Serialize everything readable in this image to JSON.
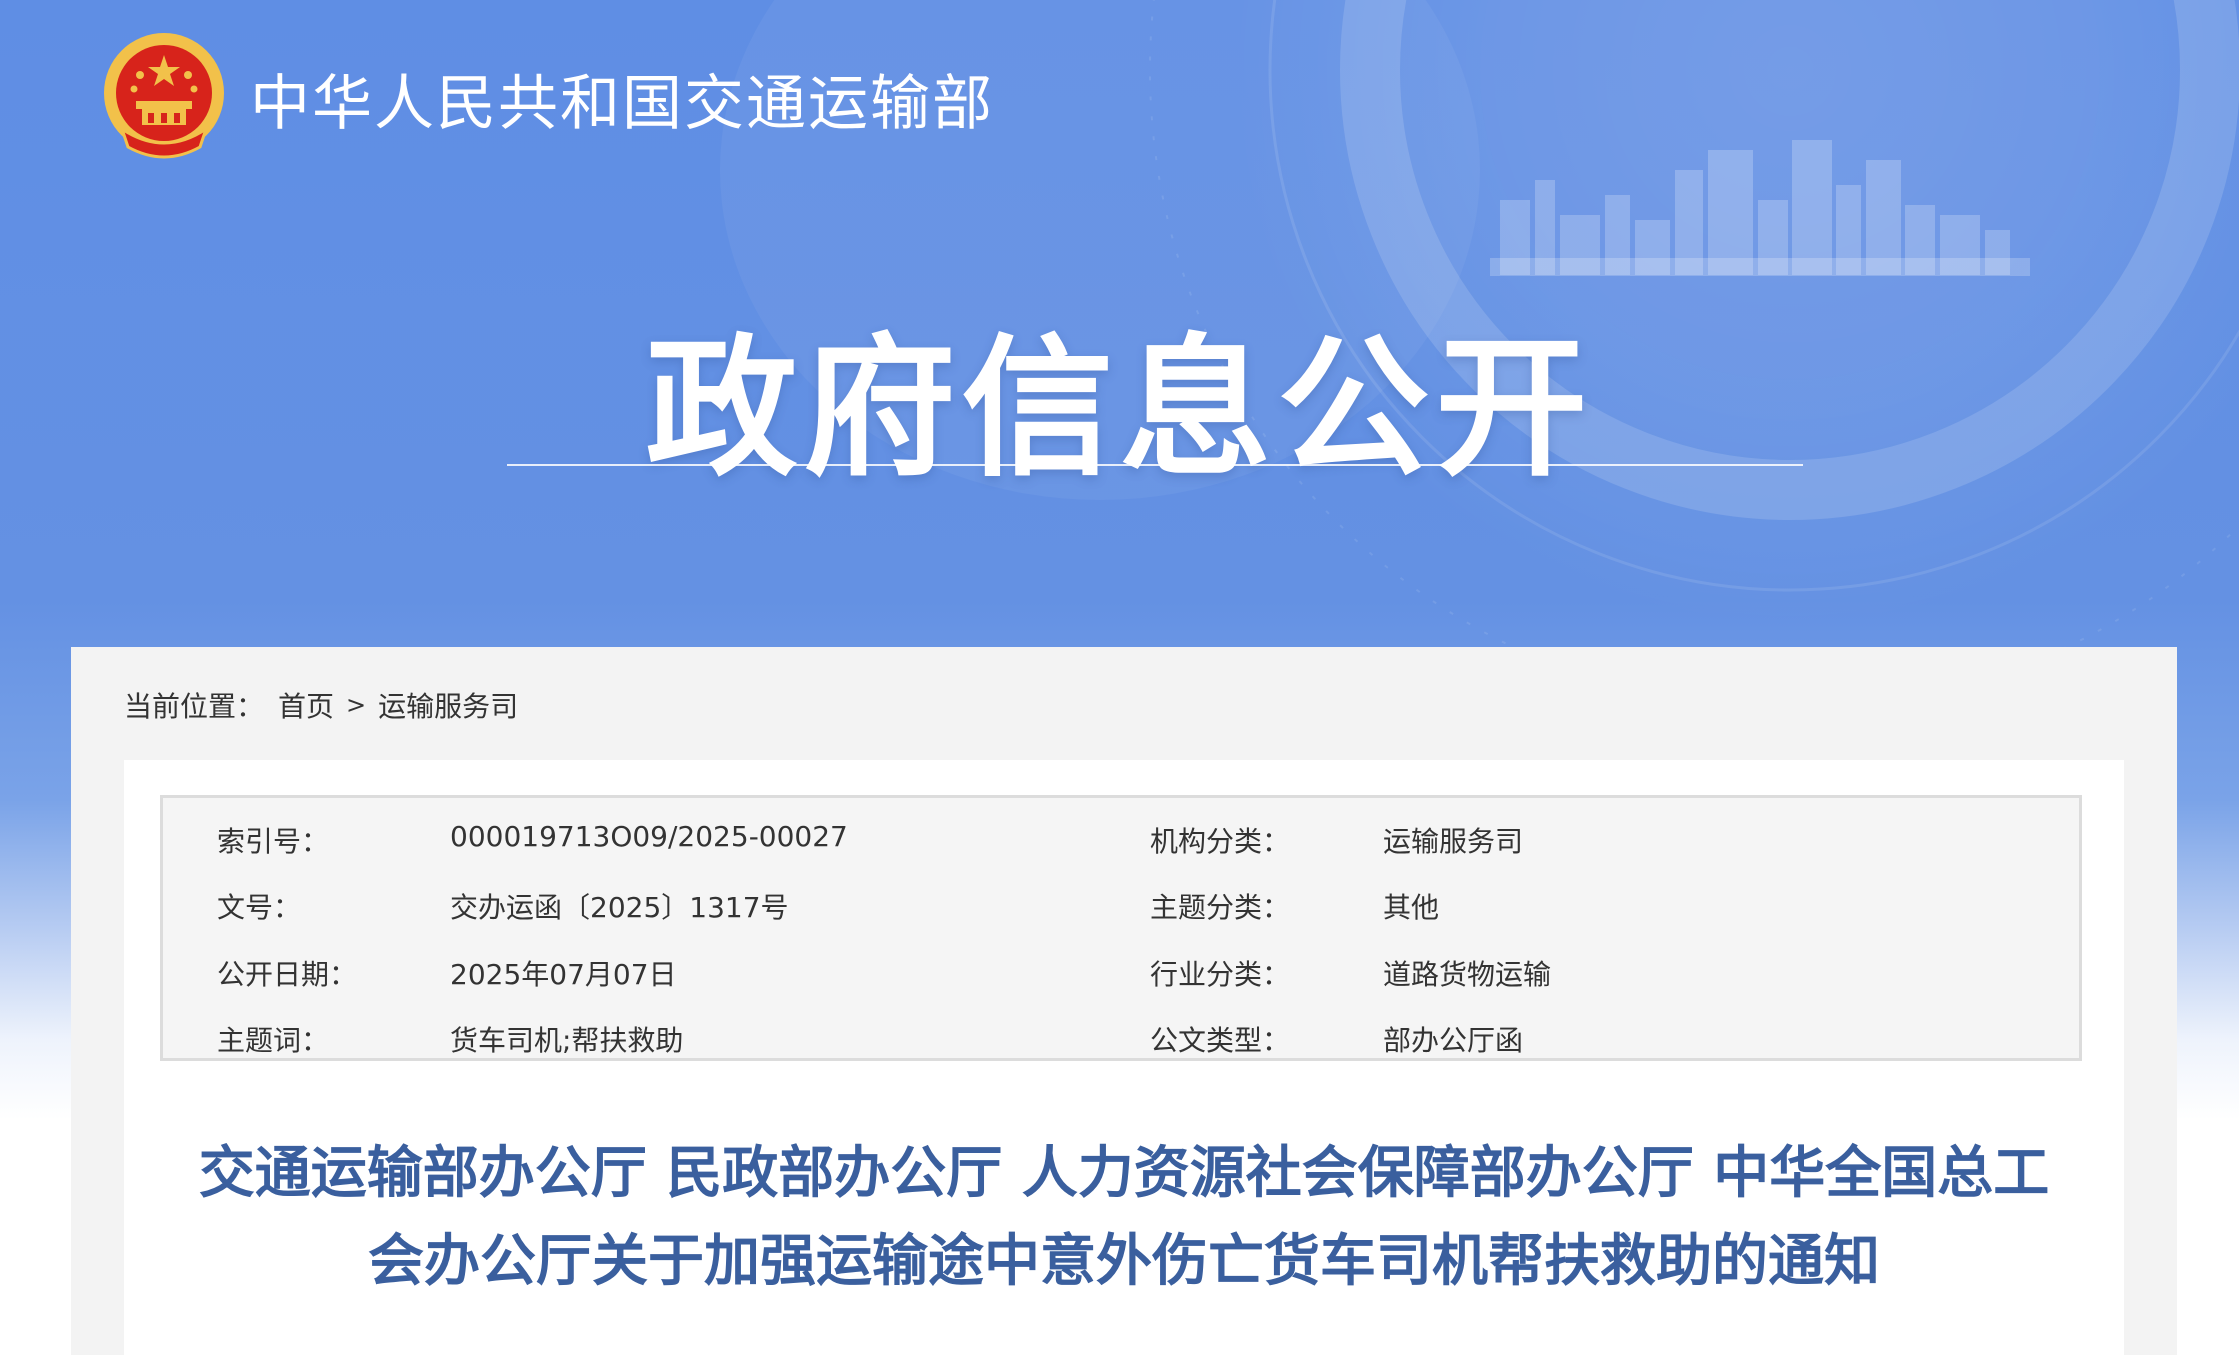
{
  "header": {
    "ministry_name": "中华人民共和国交通运输部"
  },
  "banner": {
    "title": "政府信息公开"
  },
  "breadcrumb": {
    "prefix": "当前位置：",
    "home": "首页",
    "separator": ">",
    "current": "运输服务司"
  },
  "meta": {
    "rows": [
      {
        "label1": "索引号：",
        "value1": "000019713O09/2025-00027",
        "label2": "机构分类：",
        "value2": "运输服务司"
      },
      {
        "label1": "文号：",
        "value1": "交办运函〔2025〕1317号",
        "label2": "主题分类：",
        "value2": "其他"
      },
      {
        "label1": "公开日期：",
        "value1": "2025年07月07日",
        "label2": "行业分类：",
        "value2": "道路货物运输"
      },
      {
        "label1": "主题词：",
        "value1": "货车司机;帮扶救助",
        "label2": "公文类型：",
        "value2": "部办公厅函"
      }
    ]
  },
  "document": {
    "title_line1": "交通运输部办公厅 民政部办公厅 人力资源社会保障部办公厅 中华全国总工",
    "title_line2": "会办公厅关于加强运输途中意外伤亡货车司机帮扶救助的通知"
  },
  "colors": {
    "banner_blue": "#6491e3",
    "title_blue": "#3a5f9e",
    "emblem_red": "#d7231b",
    "emblem_gold": "#f2c14a"
  }
}
